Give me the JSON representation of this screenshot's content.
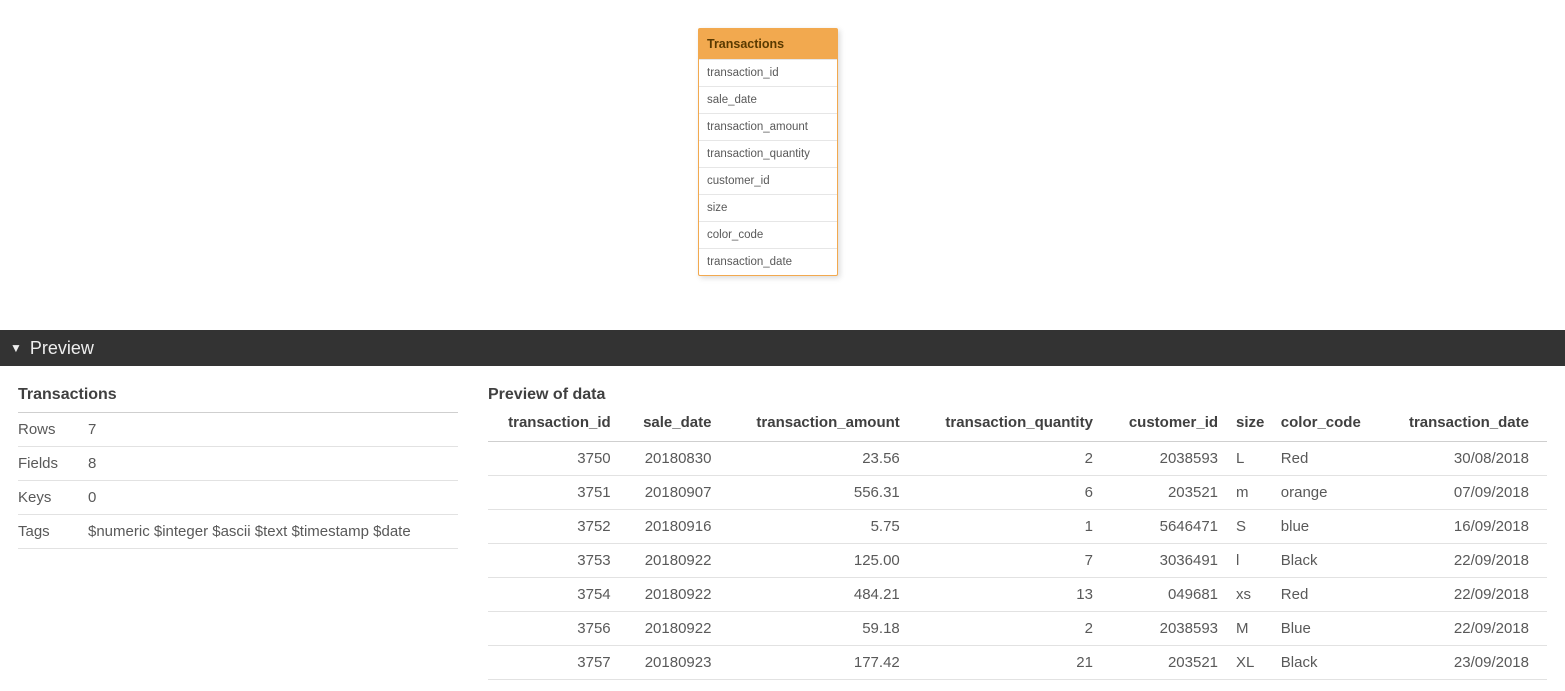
{
  "tableCard": {
    "title": "Transactions",
    "fields": [
      "transaction_id",
      "sale_date",
      "transaction_amount",
      "transaction_quantity",
      "customer_id",
      "size",
      "color_code",
      "transaction_date"
    ]
  },
  "previewHeader": {
    "label": "Preview"
  },
  "meta": {
    "title": "Transactions",
    "rows_label": "Rows",
    "rows_value": "7",
    "fields_label": "Fields",
    "fields_value": "8",
    "keys_label": "Keys",
    "keys_value": "0",
    "tags_label": "Tags",
    "tags_value": "$numeric $integer $ascii $text $timestamp $date"
  },
  "dataPreview": {
    "title": "Preview of data",
    "columns": [
      {
        "label": "transaction_id",
        "align": "num"
      },
      {
        "label": "sale_date",
        "align": "num"
      },
      {
        "label": "transaction_amount",
        "align": "num"
      },
      {
        "label": "transaction_quantity",
        "align": "num"
      },
      {
        "label": "customer_id",
        "align": "num"
      },
      {
        "label": "size",
        "align": "txt"
      },
      {
        "label": "color_code",
        "align": "txt"
      },
      {
        "label": "transaction_date",
        "align": "num"
      }
    ],
    "rows": [
      [
        "3750",
        "20180830",
        "23.56",
        "2",
        "2038593",
        "L",
        "Red",
        "30/08/2018"
      ],
      [
        "3751",
        "20180907",
        "556.31",
        "6",
        "203521",
        "m",
        "orange",
        "07/09/2018"
      ],
      [
        "3752",
        "20180916",
        "5.75",
        "1",
        "5646471",
        "S",
        "blue",
        "16/09/2018"
      ],
      [
        "3753",
        "20180922",
        "125.00",
        "7",
        "3036491",
        "l",
        "Black",
        "22/09/2018"
      ],
      [
        "3754",
        "20180922",
        "484.21",
        "13",
        "049681",
        "xs",
        "Red",
        "22/09/2018"
      ],
      [
        "3756",
        "20180922",
        "59.18",
        "2",
        "2038593",
        "M",
        "Blue",
        "22/09/2018"
      ],
      [
        "3757",
        "20180923",
        "177.42",
        "21",
        "203521",
        "XL",
        "Black",
        "23/09/2018"
      ]
    ]
  }
}
